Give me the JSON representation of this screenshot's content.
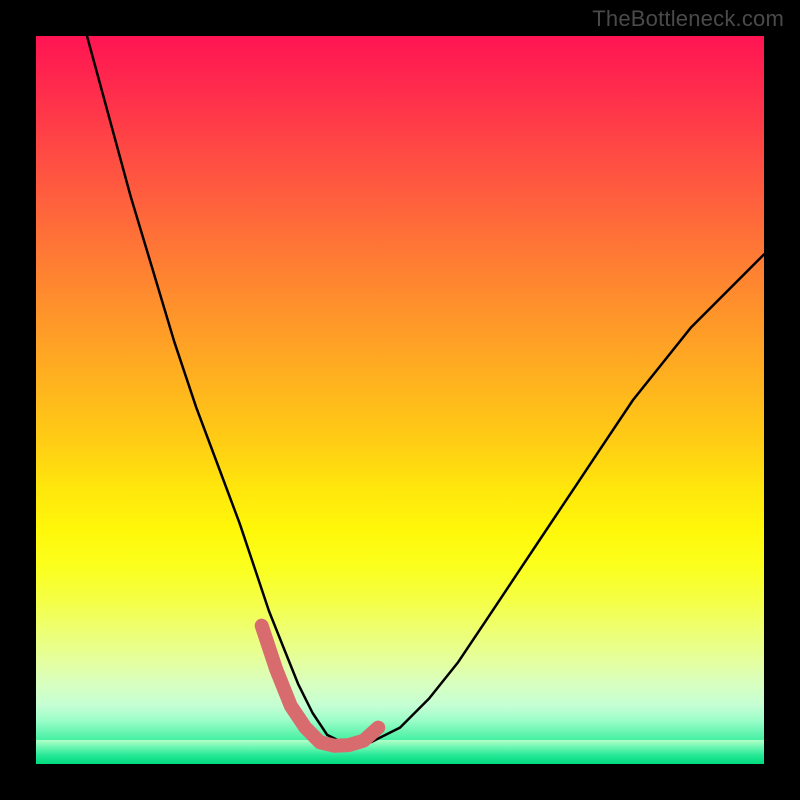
{
  "watermark_text": "TheBottleneck.com",
  "chart_data": {
    "type": "line",
    "title": "",
    "xlabel": "",
    "ylabel": "",
    "xlim": [
      0,
      100
    ],
    "ylim": [
      0,
      100
    ],
    "grid": false,
    "note": "V-shaped bottleneck curve over a vertical red→yellow→green gradient. Minimum highlighted by a thick desaturated-red stroke near the bottom.",
    "series": [
      {
        "name": "bottleneck-curve",
        "x": [
          7,
          10,
          13,
          16,
          19,
          22,
          25,
          28,
          30,
          32,
          34,
          36,
          38,
          40,
          43,
          46,
          50,
          54,
          58,
          62,
          66,
          70,
          74,
          78,
          82,
          86,
          90,
          94,
          98,
          100
        ],
        "y": [
          100,
          89,
          78,
          68,
          58,
          49,
          41,
          33,
          27,
          21,
          16,
          11,
          7,
          4,
          2.5,
          3,
          5,
          9,
          14,
          20,
          26,
          32,
          38,
          44,
          50,
          55,
          60,
          64,
          68,
          70
        ]
      }
    ],
    "highlight_valley": {
      "name": "valley-highlight",
      "color": "#d86b6e",
      "x": [
        31,
        33,
        35,
        37,
        39,
        41,
        43,
        45,
        47
      ],
      "y": [
        19,
        13,
        8,
        5,
        3,
        2.5,
        2.6,
        3.2,
        5
      ]
    },
    "background_gradient": {
      "direction": "top-to-bottom",
      "stops": [
        {
          "pos": 0,
          "color": "#ff1452"
        },
        {
          "pos": 50,
          "color": "#ffc414"
        },
        {
          "pos": 82,
          "color": "#f6ff60"
        },
        {
          "pos": 100,
          "color": "#00d97c"
        }
      ]
    }
  }
}
